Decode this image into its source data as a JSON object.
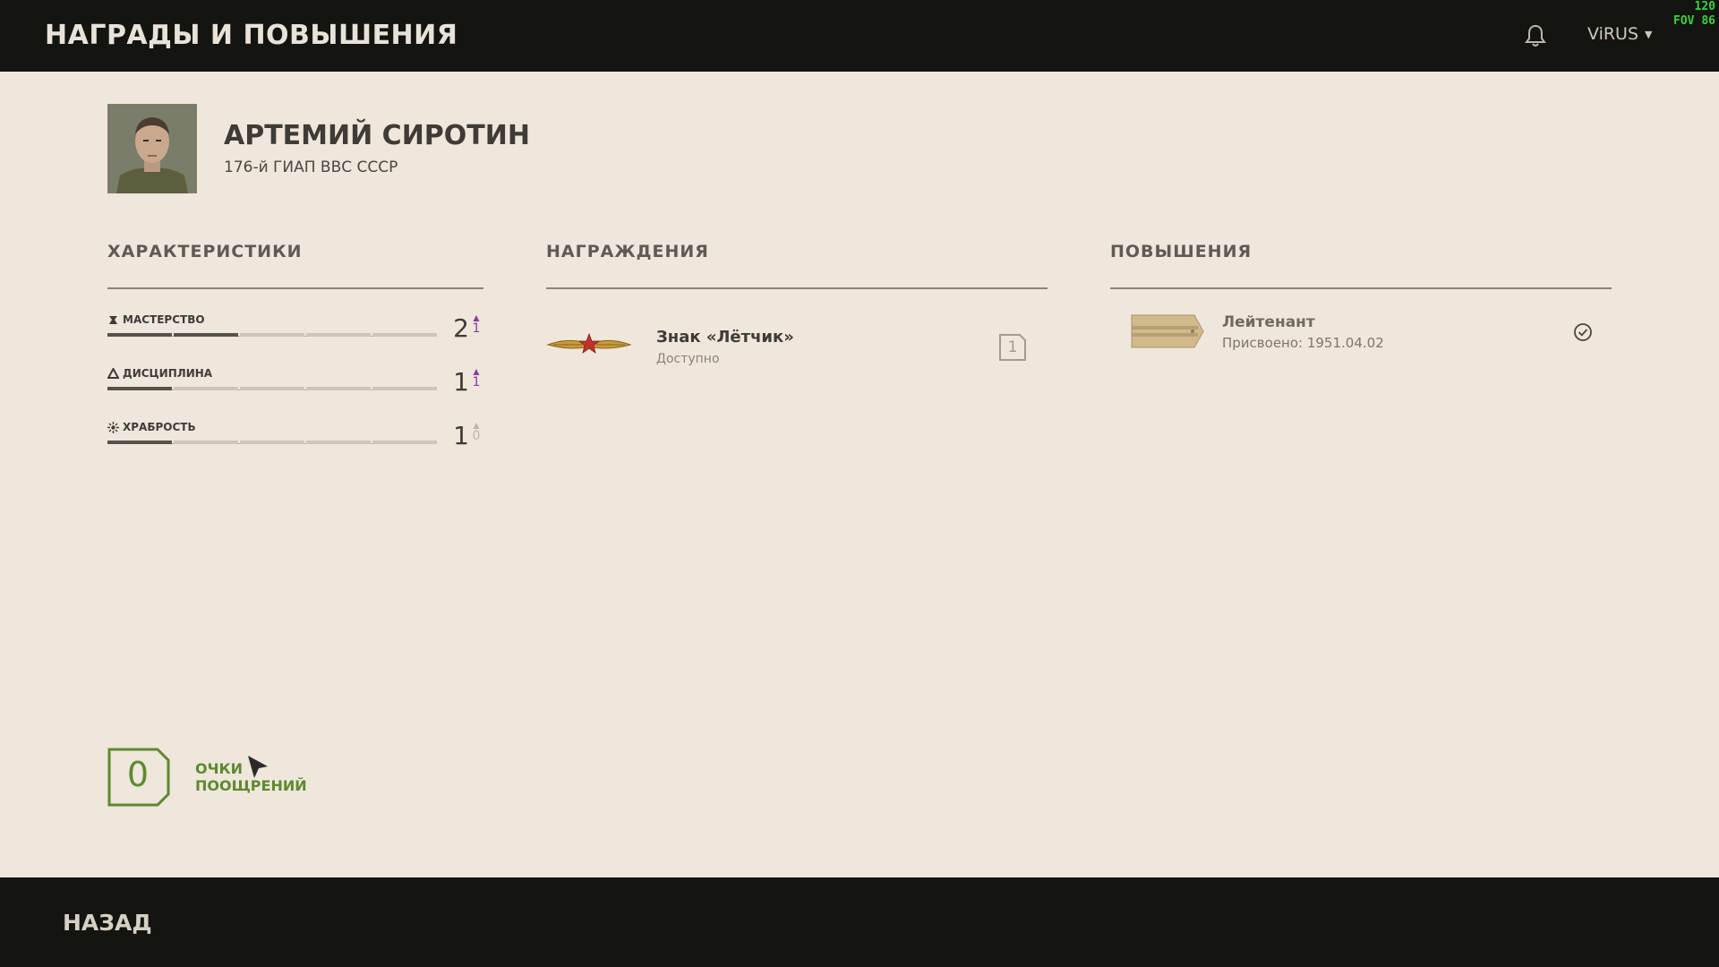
{
  "header": {
    "title": "НАГРАДЫ И ПОВЫШЕНИЯ",
    "username": "ViRUS",
    "overlay_line1": "120",
    "overlay_line2": "FOV 86"
  },
  "player": {
    "name": "АРТЕМИЙ СИРОТИН",
    "unit": "176-й ГИАП ВВС СССР"
  },
  "sections": {
    "characteristics": "ХАРАКТЕРИСТИКИ",
    "awards": "НАГРАЖДЕНИЯ",
    "promotions": "ПОВЫШЕНИЯ"
  },
  "stats": [
    {
      "label": "МАСТЕРСТВО",
      "value": "2",
      "increase": "1",
      "level": 2,
      "max": 5,
      "icon": "mastery-icon"
    },
    {
      "label": "ДИСЦИПЛИНА",
      "value": "1",
      "increase": "1",
      "level": 1,
      "max": 5,
      "icon": "discipline-icon"
    },
    {
      "label": "ХРАБРОСТЬ",
      "value": "1",
      "increase": "0",
      "level": 1,
      "max": 5,
      "icon": "bravery-icon"
    }
  ],
  "awards": [
    {
      "name": "Знак «Лётчик»",
      "status": "Доступно",
      "count": "1",
      "icon": "pilot-badge-icon"
    }
  ],
  "promotions": [
    {
      "rank": "Лейтенант",
      "date": "Присвоено: 1951.04.02",
      "icon": "shoulder-strap-icon",
      "status_icon": "check-circle-icon"
    }
  ],
  "points": {
    "value": "0",
    "label_line1": "ОЧКИ",
    "label_line2": "ПООЩРЕНИЙ"
  },
  "footer": {
    "back_label": "НАЗАД"
  },
  "colors": {
    "background": "#efe6dc",
    "bar": "#141411",
    "accent_green": "#5d8a2e",
    "accent_purple": "#8a3e9a"
  }
}
